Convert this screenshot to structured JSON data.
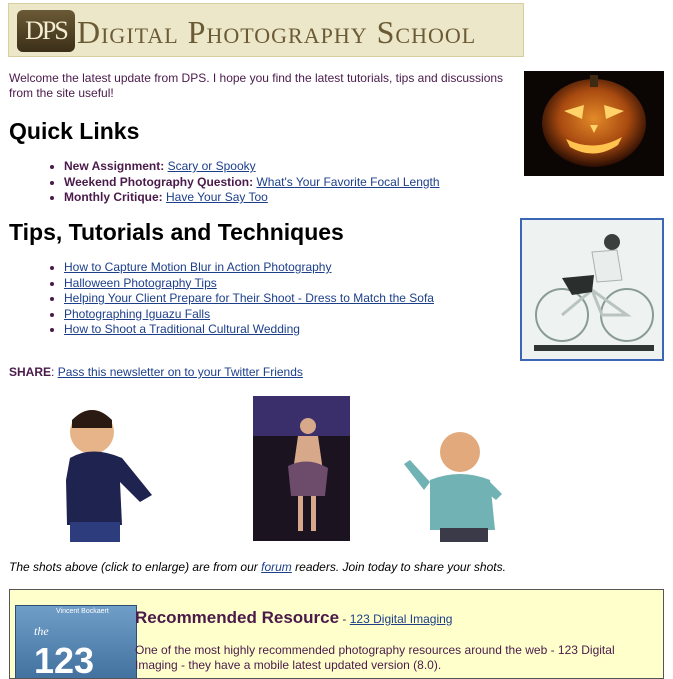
{
  "header": {
    "logo_mark": "DPS",
    "logo_text": "Digital Photography School"
  },
  "intro": "Welcome the latest update from DPS. I hope you find the latest tutorials, tips and discussions from the site useful!",
  "quick_links": {
    "title": "Quick Links",
    "items": [
      {
        "label": "New Assignment:",
        "link": "Scary or Spooky"
      },
      {
        "label": "Weekend Photography Question:",
        "link": "What's Your Favorite Focal Length"
      },
      {
        "label": "Monthly Critique:",
        "link": "Have Your Say Too"
      }
    ]
  },
  "tips": {
    "title": "Tips, Tutorials and Techniques",
    "items": [
      "How to Capture Motion Blur in Action Photography",
      "Halloween Photography Tips",
      "Helping Your Client Prepare for Their Shoot - Dress to Match the Sofa",
      "Photographing Iguazu Falls",
      "How to Shoot a Traditional Cultural Wedding"
    ]
  },
  "share": {
    "label": "SHARE",
    "link": "Pass this newsletter on to your Twitter Friends"
  },
  "caption": {
    "before": "The shots above (click to enlarge) are from our ",
    "link": "forum",
    "after": " readers. Join today to share your shots."
  },
  "recommended": {
    "title": "Recommended Resource",
    "dash": " - ",
    "link": "123 Digital Imaging",
    "body": "One of the most highly recommended photography resources around the web - 123 Digital Imaging - they have a mobile latest updated version (8.0).",
    "book_author": "Vincent Bockaert",
    "book_title": "the",
    "book_num": "123"
  }
}
